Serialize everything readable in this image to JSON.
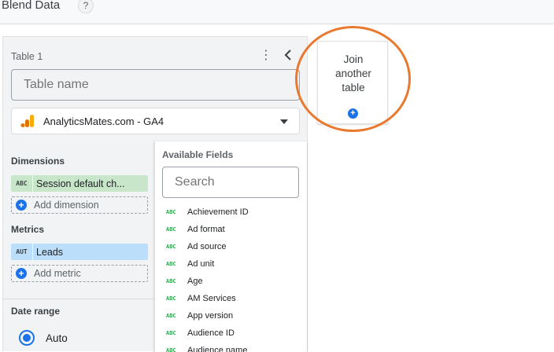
{
  "header": {
    "title": "Blend Data",
    "help": "?"
  },
  "table": {
    "label": "Table 1",
    "kebab": "⋮",
    "name_placeholder": "Table name",
    "source": "AnalyticsMates.com - GA4"
  },
  "dimensions": {
    "title": "Dimensions",
    "items": [
      {
        "type": "ABC",
        "label": "Session default ch..."
      }
    ],
    "add_label": "Add dimension"
  },
  "metrics": {
    "title": "Metrics",
    "items": [
      {
        "type": "AUT",
        "label": "Leads"
      }
    ],
    "add_label": "Add metric"
  },
  "date_range": {
    "title": "Date range",
    "option": "Auto"
  },
  "available_fields": {
    "title": "Available Fields",
    "search_placeholder": "Search",
    "type_badge": "ABC",
    "items": [
      "Achievement ID",
      "Ad format",
      "Ad source",
      "Ad unit",
      "Age",
      "AM Services",
      "App version",
      "Audience ID",
      "Audience name"
    ]
  },
  "join": {
    "text": "Join\nanother\ntable",
    "plus": "+"
  },
  "colors": {
    "accent": "#1a73e8",
    "dimension_chip": "#c8e6c9",
    "metric_chip": "#bbdefb",
    "highlight": "#e8792f"
  },
  "icons": [
    "help-icon",
    "kebab-icon",
    "collapse-icon",
    "google-analytics-icon",
    "dropdown-icon",
    "plus-icon"
  ]
}
